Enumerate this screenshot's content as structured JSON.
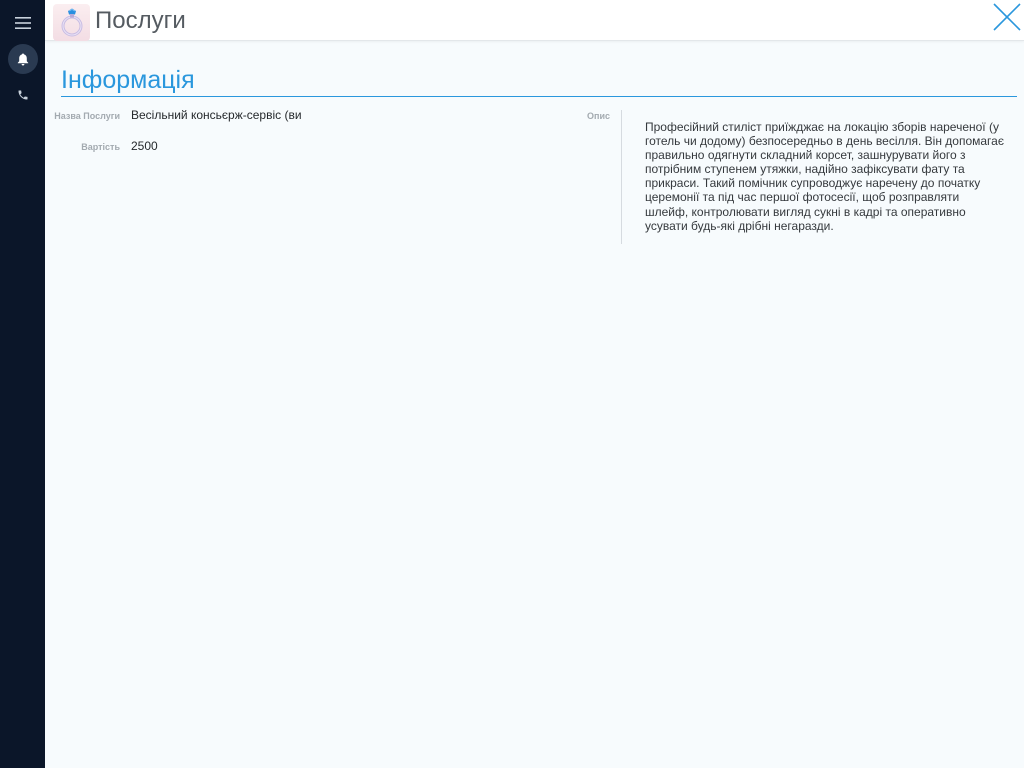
{
  "header": {
    "title": "Послуги"
  },
  "section": {
    "title": "Інформація"
  },
  "fields": {
    "name_label": "Назва Послуги",
    "name_value": "Весільний консьєрж-сервіс (ви",
    "price_label": "Вартість",
    "price_value": "2500",
    "description_label": "Опис",
    "description_value": "Професійний стиліст приїжджає на локацію зборів нареченої (у готель чи додому) безпосередньо в день весілля. Він допомагає правильно одягнути складний корсет, зашнурувати його з потрібним ступенем утяжки, надійно зафіксувати фату та прикраси. Такий помічник супроводжує наречену до початку церемонії та під час першої фотосесії, щоб розправляти шлейф, контролювати вигляд сукні в кадрі та оперативно усувати будь-які дрібні негаразди."
  },
  "icons": {
    "menu": "hamburger-menu-icon",
    "notifications": "bell-icon",
    "phone": "phone-icon",
    "logo": "ring-icon",
    "close": "close-icon"
  },
  "colors": {
    "sidebar": "#0b1629",
    "accent": "#2a97dd",
    "background": "#f7fbfd"
  }
}
